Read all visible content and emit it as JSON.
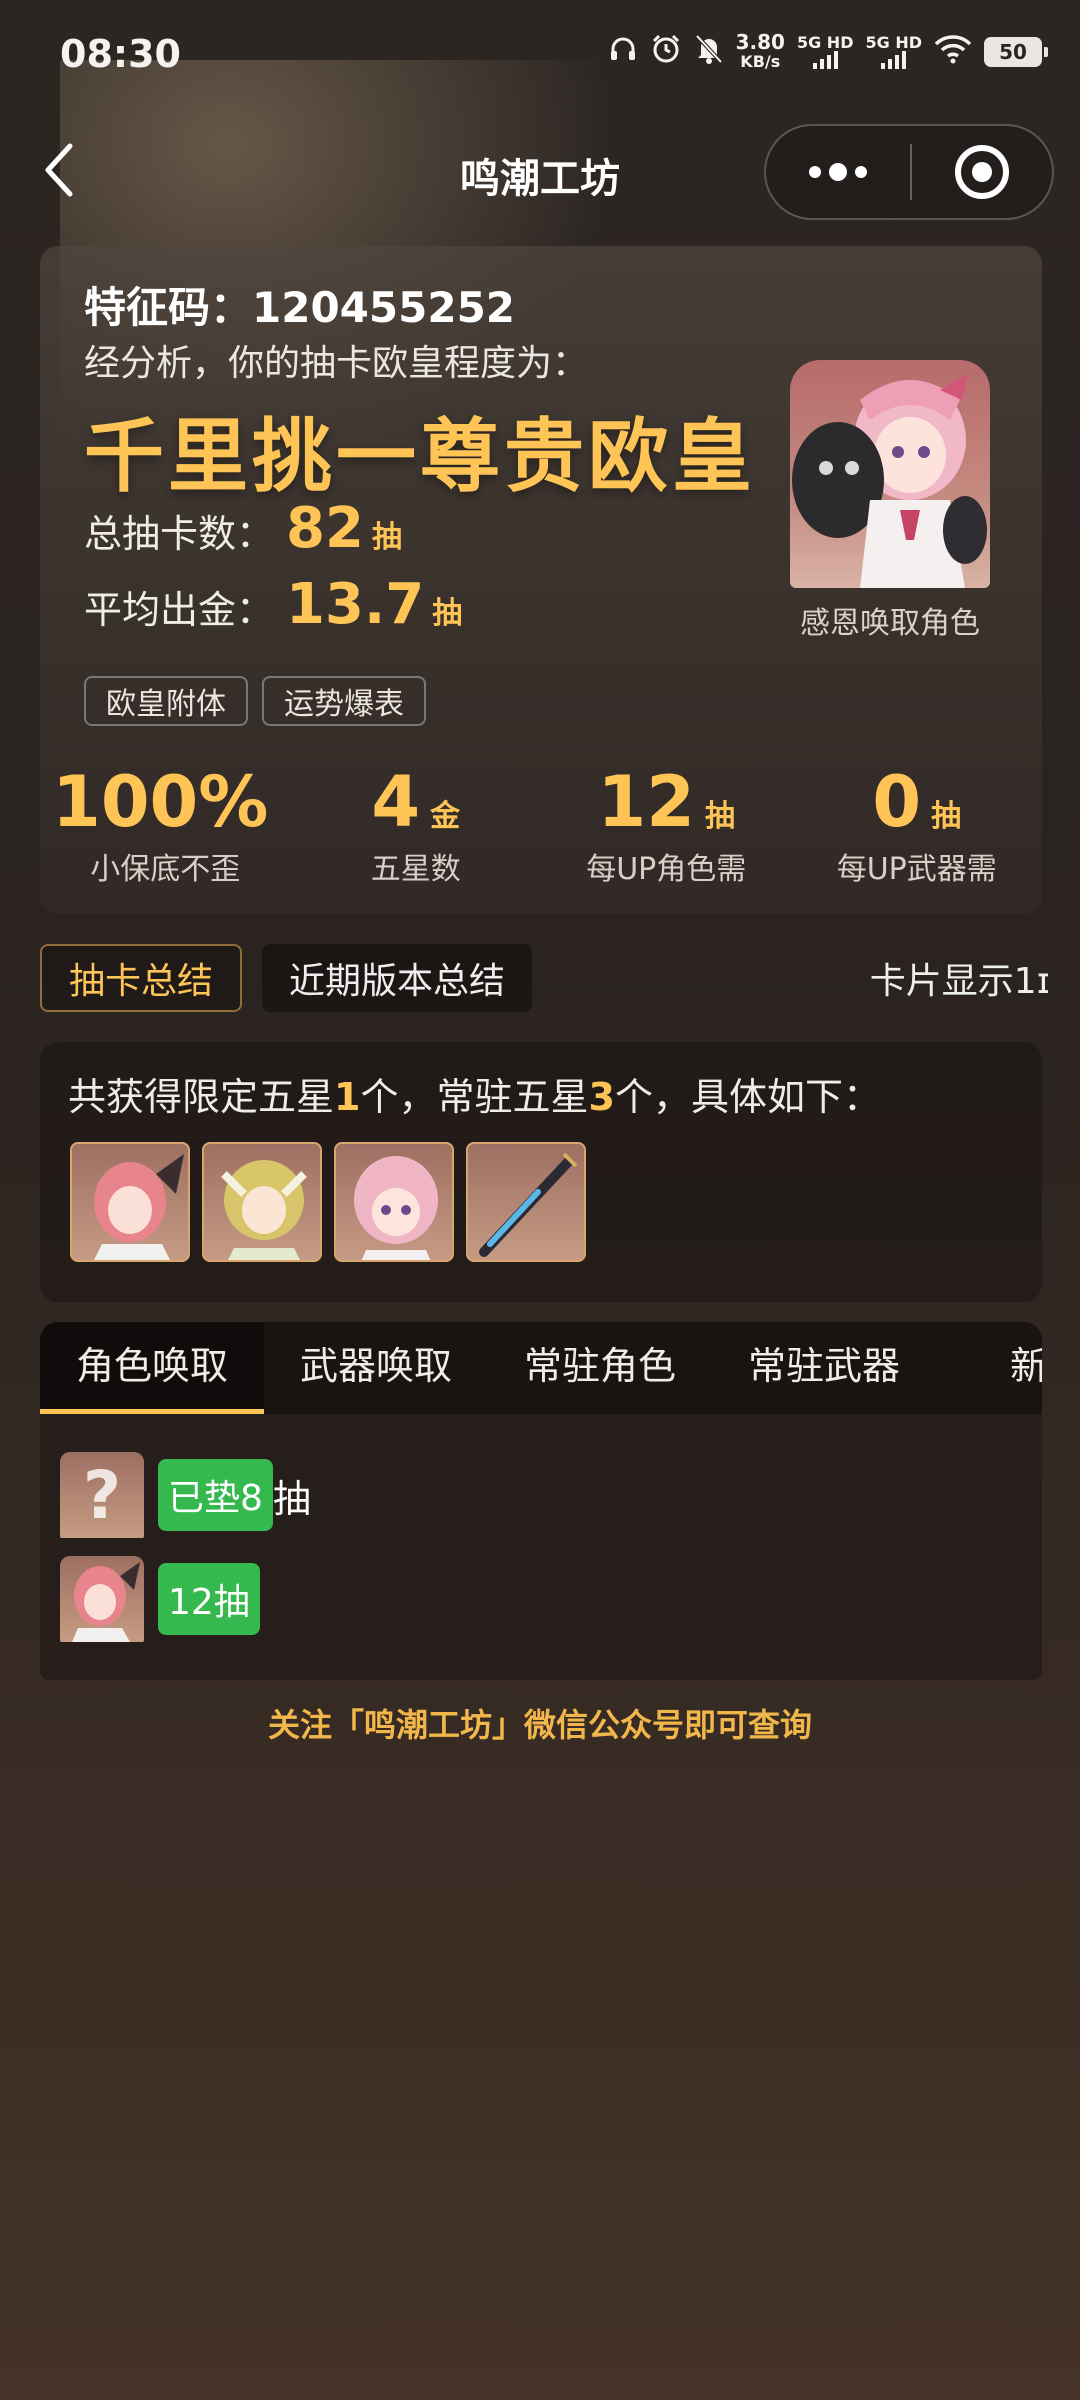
{
  "status_bar": {
    "time": "08:30",
    "net_speed_value": "3.80",
    "net_speed_unit": "KB/s",
    "signal_1": "5G HD",
    "signal_2": "5G HD",
    "battery": "50",
    "icons": [
      "headphones-icon",
      "alarm-icon",
      "mute-icon",
      "signal-icon",
      "wifi-icon",
      "battery-icon"
    ]
  },
  "navbar": {
    "title": "鸣潮工坊",
    "icons": [
      "back-icon",
      "more-icon",
      "close-target-icon"
    ]
  },
  "summary": {
    "code_label": "特征码：",
    "code_value": "120455252",
    "analysis": "经分析，你的抽卡欧皇程度为：",
    "rank": "千里挑一尊贵欧皇",
    "total_label": "总抽卡数：",
    "total_value": "82",
    "total_unit": "抽",
    "avg_label": "平均出金：",
    "avg_value": "13.7",
    "avg_unit": "抽",
    "tags": [
      "欧皇附体",
      "运势爆表"
    ],
    "portrait_caption": "感恩唤取角色",
    "metrics": [
      {
        "value": "100%",
        "unit": "",
        "label": "小保底不歪"
      },
      {
        "value": "4",
        "unit": "金",
        "label": "五星数"
      },
      {
        "value": "12",
        "unit": "抽",
        "label": "每UP角色需"
      },
      {
        "value": "0",
        "unit": "抽",
        "label": "每UP武器需"
      }
    ]
  },
  "summary_tabs": {
    "active": "抽卡总结",
    "inactive": "近期版本总结",
    "display_toggle": "卡片显示1ɪ"
  },
  "got": {
    "prefix": "共获得限定五星",
    "limited_count": "1",
    "middle": "个，常驻五星",
    "standard_count": "3",
    "suffix": "个，具体如下：",
    "thumb_count": 4
  },
  "pool_tabs": [
    "角色唤取",
    "武器唤取",
    "常驻角色",
    "常驻武器",
    "新手"
  ],
  "records": [
    {
      "pill": "已垫8",
      "after": "抽",
      "unknown": true,
      "mark": "?"
    },
    {
      "pill": "12抽",
      "after": "",
      "unknown": false
    }
  ],
  "footer_note": "关注「鸣潮工坊」微信公众号即可查询",
  "colors": {
    "accent_gold": "#ffc456",
    "pill_green": "#35b94f",
    "background": "#2c2623"
  }
}
